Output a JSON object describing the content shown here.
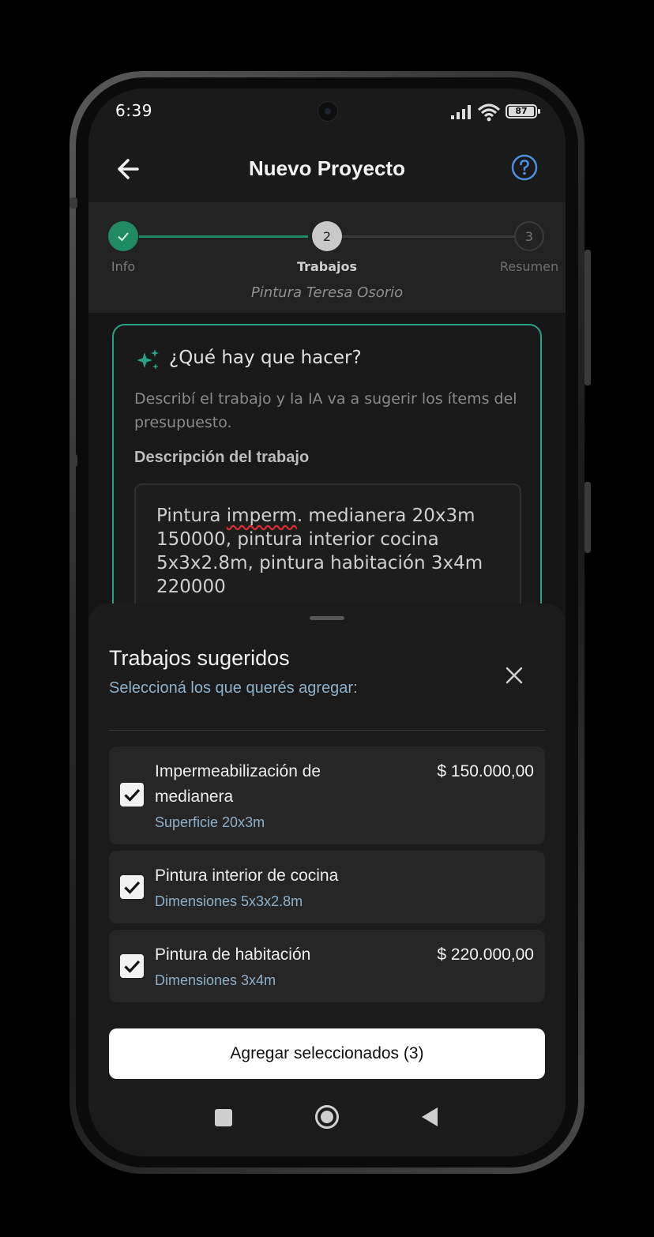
{
  "status_bar": {
    "time": "6:39",
    "battery": "87",
    "icons": [
      "signal-icon",
      "wifi-icon",
      "battery-icon"
    ]
  },
  "app_bar": {
    "title": "Nuevo Proyecto",
    "back_icon": "arrow-left-icon",
    "help_icon": "help-circle-icon",
    "help_color": "#4a90e2"
  },
  "stepper": {
    "steps": [
      {
        "number": "1",
        "label": "Info",
        "state": "done"
      },
      {
        "number": "2",
        "label": "Trabajos",
        "state": "current"
      },
      {
        "number": "3",
        "label": "Resumen",
        "state": "pending"
      }
    ],
    "project_name": "Pintura Teresa Osorio",
    "accent_color": "#1f8a63"
  },
  "ai_card": {
    "title": "¿Qué hay que hacer?",
    "icon": "sparkles-icon",
    "description": "Describí el trabajo y la IA va a sugerir los ítems del presupuesto.",
    "field_label": "Descripción del trabajo",
    "field_value": {
      "before": "Pintura ",
      "misspelled": "imperm",
      "after": ". medianera 20x3m 150000, pintura interior cocina 5x3x2.8m, pintura habitación 3x4m 220000"
    },
    "border_color": "#2aa084"
  },
  "sheet": {
    "title": "Trabajos sugeridos",
    "subtitle": "Seleccioná los que querés agregar:",
    "close_icon": "close-icon",
    "items": [
      {
        "name": "Impermeabilización de medianera",
        "detail": "Superficie 20x3m",
        "price": "$ 150.000,00",
        "checked": true
      },
      {
        "name": "Pintura interior de cocina",
        "detail": "Dimensiones 5x3x2.8m",
        "price": "",
        "checked": true
      },
      {
        "name": "Pintura de habitación",
        "detail": "Dimensiones 3x4m",
        "price": "$ 220.000,00",
        "checked": true
      }
    ],
    "add_button": "Agregar seleccionados (3)"
  },
  "nav_bar": {
    "icons": [
      "recents-square-icon",
      "home-circle-icon",
      "back-triangle-icon"
    ]
  }
}
